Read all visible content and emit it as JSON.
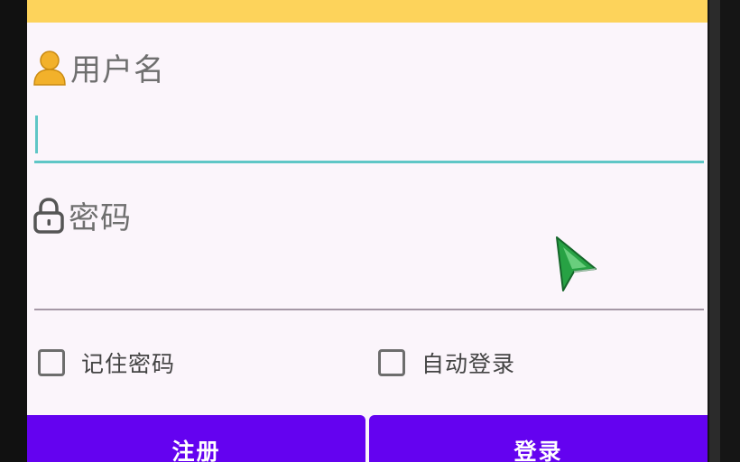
{
  "colors": {
    "topbar": "#fdd35b",
    "screen_background": "#fbf5fb",
    "label_text": "#6f6f6f",
    "username_underline": "#5fc6c6",
    "password_underline": "#a598a6",
    "button_background": "#6402f0",
    "button_text": "#ffffff",
    "user_icon": "#f2b12b",
    "cursor": "#27a244"
  },
  "form": {
    "username": {
      "icon": "user-icon",
      "label": "用户名",
      "value": ""
    },
    "password": {
      "icon": "lock-icon",
      "label": "密码",
      "value": ""
    },
    "remember_password": {
      "label": "记住密码",
      "checked": false
    },
    "auto_login": {
      "label": "自动登录",
      "checked": false
    }
  },
  "buttons": {
    "register": "注册",
    "login": "登录"
  },
  "pointer": {
    "icon": "mouse-pointer-icon"
  }
}
